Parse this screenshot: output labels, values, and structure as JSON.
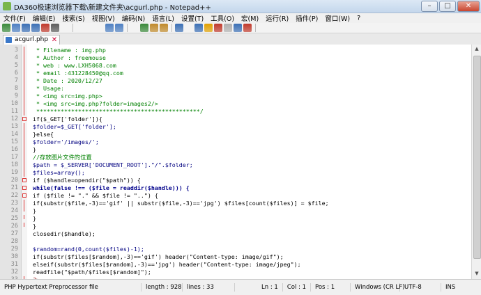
{
  "window": {
    "title": "DA360极速浏览器下载\\新建文件夹\\acgurl.php - Notepad++"
  },
  "menu": [
    "文件(F)",
    "编辑(E)",
    "搜索(S)",
    "视图(V)",
    "编码(N)",
    "语言(L)",
    "设置(T)",
    "工具(O)",
    "宏(M)",
    "运行(R)",
    "插件(P)",
    "窗口(W)",
    "?"
  ],
  "tab": {
    "label": "acgurl.php"
  },
  "code_lines": [
    {
      "n": "3",
      "text": " * Filename : img.php",
      "cls": "cmt",
      "fold": "line"
    },
    {
      "n": "4",
      "text": " * Author : freemouse",
      "cls": "cmt",
      "fold": "line"
    },
    {
      "n": "5",
      "text": " * web : www.LXH5068.com",
      "cls": "cmt",
      "fold": "line"
    },
    {
      "n": "6",
      "text": " * email :431228450@qq.com",
      "cls": "cmt",
      "fold": "line"
    },
    {
      "n": "7",
      "text": " * Date : 2020/12/27",
      "cls": "cmt",
      "fold": "line"
    },
    {
      "n": "8",
      "text": " * Usage:",
      "cls": "cmt",
      "fold": "line"
    },
    {
      "n": "9",
      "text": " * <img src=img.php>",
      "cls": "cmt",
      "fold": "line"
    },
    {
      "n": "10",
      "text": " * <img src=img.php?folder=images2/>",
      "cls": "cmt",
      "fold": "line"
    },
    {
      "n": "11",
      "text": " ***********************************************/",
      "cls": "cmt",
      "fold": "line"
    },
    {
      "n": "12",
      "text": "if($_GET['folder']){",
      "cls": "plain",
      "fold": "box"
    },
    {
      "n": "13",
      "text": "$folder=$_GET['folder'];",
      "cls": "var",
      "fold": "line"
    },
    {
      "n": "14",
      "text": "}else{",
      "cls": "plain",
      "fold": "line"
    },
    {
      "n": "15",
      "text": "$folder='/images/';",
      "cls": "var",
      "fold": "line"
    },
    {
      "n": "16",
      "text": "}",
      "cls": "plain",
      "fold": "line"
    },
    {
      "n": "17",
      "text": "//存放图片文件的位置",
      "cls": "cmt",
      "fold": "line"
    },
    {
      "n": "18",
      "text": "$path = $_SERVER['DOCUMENT_ROOT'].\"/\".$folder;",
      "cls": "var",
      "fold": "line"
    },
    {
      "n": "19",
      "text": "$files=array();",
      "cls": "var",
      "fold": "line"
    },
    {
      "n": "20",
      "text": "if ($handle=opendir(\"$path\")) {",
      "cls": "plain",
      "fold": "box"
    },
    {
      "n": "21",
      "text": "while(false !== ($file = readdir($handle))) {",
      "cls": "kw",
      "fold": "box"
    },
    {
      "n": "22",
      "text": "if ($file != \".\" && $file != \"..\") {",
      "cls": "plain",
      "fold": "box"
    },
    {
      "n": "23",
      "text": "if(substr($file,-3)=='gif' || substr($file,-3)=='jpg') $files[count($files)] = $file;",
      "cls": "plain",
      "fold": "line"
    },
    {
      "n": "24",
      "text": "}",
      "cls": "plain",
      "fold": "end"
    },
    {
      "n": "25",
      "text": "}",
      "cls": "plain",
      "fold": "end"
    },
    {
      "n": "26",
      "text": "}",
      "cls": "plain",
      "fold": "end"
    },
    {
      "n": "27",
      "text": "closedir($handle);",
      "cls": "plain",
      "fold": "none"
    },
    {
      "n": "28",
      "text": "",
      "cls": "plain",
      "fold": "none"
    },
    {
      "n": "29",
      "text": "$random=rand(0,count($files)-1);",
      "cls": "var",
      "fold": "none"
    },
    {
      "n": "30",
      "text": "if(substr($files[$random],-3)=='gif') header(\"Content-type: image/gif\");",
      "cls": "plain",
      "fold": "none"
    },
    {
      "n": "31",
      "text": "elseif(substr($files[$random],-3)=='jpg') header(\"Content-type: image/jpeg\");",
      "cls": "plain",
      "fold": "none"
    },
    {
      "n": "32",
      "text": "readfile(\"$path/$files[$random]\");",
      "cls": "plain",
      "fold": "none"
    },
    {
      "n": "33",
      "text": "?>",
      "cls": "op",
      "fold": "end"
    }
  ],
  "status": {
    "language": "PHP Hypertext Preprocessor file",
    "length": "length : 928",
    "lines": "lines : 33",
    "ln": "Ln : 1",
    "col": "Col : 1",
    "pos": "Pos : 1",
    "eol": "Windows (CR LF)",
    "encoding": "UTF-8",
    "mode": "INS"
  }
}
